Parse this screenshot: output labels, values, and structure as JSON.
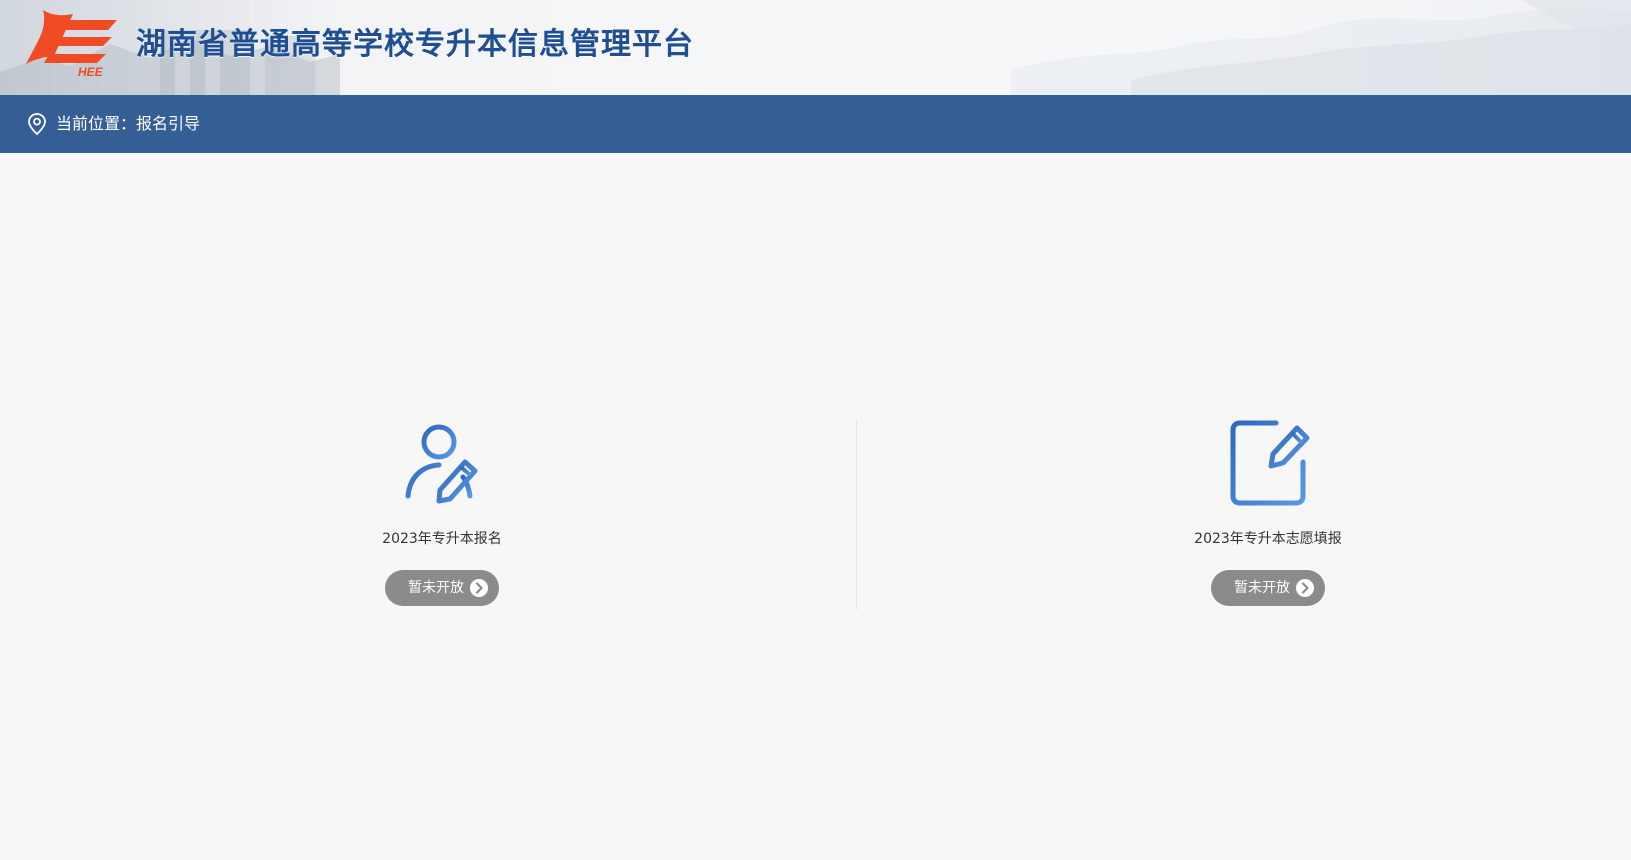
{
  "header": {
    "title": "湖南省普通高等学校专升本信息管理平台",
    "logo_text": "HEE"
  },
  "nav": {
    "location_prefix": "当前位置：",
    "current_page": "报名引导"
  },
  "cards": [
    {
      "title": "2023年专升本报名",
      "status": "暂未开放",
      "icon": "user-edit-icon"
    },
    {
      "title": "2023年专升本志愿填报",
      "status": "暂未开放",
      "icon": "form-edit-icon"
    }
  ],
  "colors": {
    "brand_blue": "#355f94",
    "title_blue": "#1f4f92",
    "logo_orange": "#ef4b24",
    "button_gray": "#8b8b8b",
    "icon_blue": "#2f73c8"
  }
}
